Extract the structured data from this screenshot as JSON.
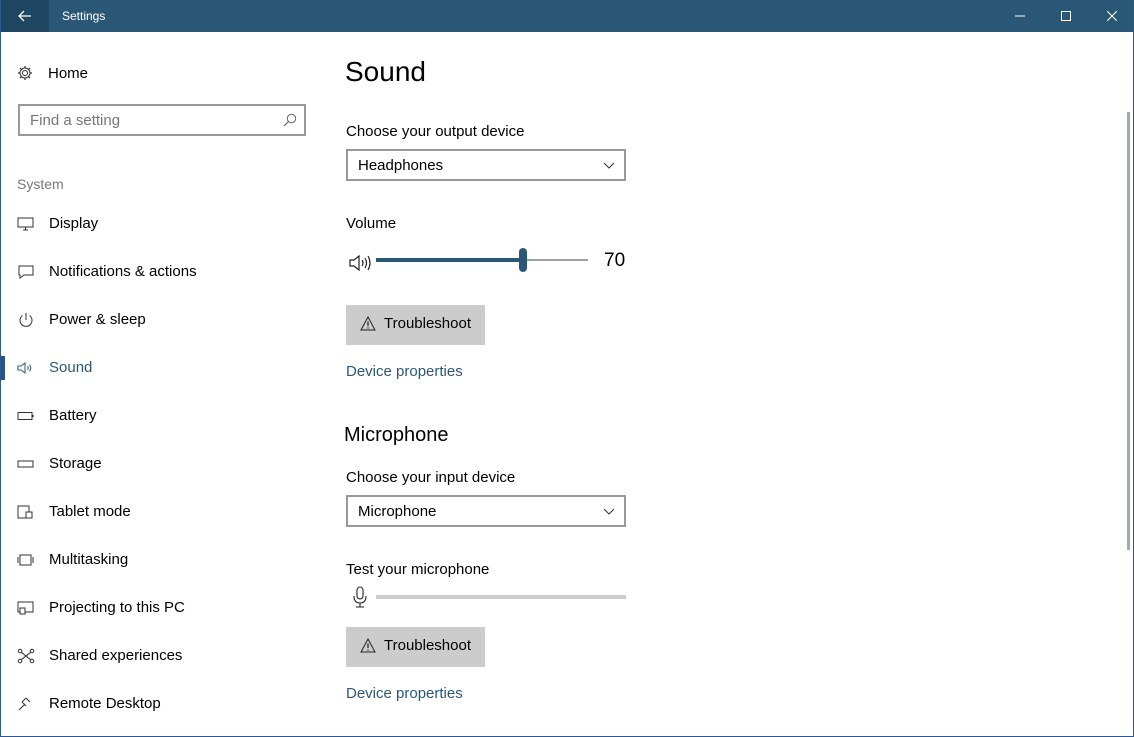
{
  "window": {
    "title": "Settings"
  },
  "sidebar": {
    "home_label": "Home",
    "search_placeholder": "Find a setting",
    "section_label": "System",
    "items": [
      {
        "label": "Display",
        "icon": "display-icon"
      },
      {
        "label": "Notifications & actions",
        "icon": "notifications-icon"
      },
      {
        "label": "Power & sleep",
        "icon": "power-icon"
      },
      {
        "label": "Sound",
        "icon": "speaker-icon",
        "active": true
      },
      {
        "label": "Battery",
        "icon": "battery-icon"
      },
      {
        "label": "Storage",
        "icon": "storage-icon"
      },
      {
        "label": "Tablet mode",
        "icon": "tablet-icon"
      },
      {
        "label": "Multitasking",
        "icon": "multitasking-icon"
      },
      {
        "label": "Projecting to this PC",
        "icon": "projecting-icon"
      },
      {
        "label": "Shared experiences",
        "icon": "shared-icon"
      },
      {
        "label": "Remote Desktop",
        "icon": "remote-desktop-icon"
      }
    ]
  },
  "main": {
    "title": "Sound",
    "output": {
      "label": "Choose your output device",
      "selected": "Headphones",
      "volume_label": "Volume",
      "volume_value": "70",
      "volume_fraction": 0.7,
      "troubleshoot_label": "Troubleshoot",
      "device_properties_label": "Device properties"
    },
    "microphone": {
      "section_title": "Microphone",
      "label": "Choose your input device",
      "selected": "Microphone",
      "test_label": "Test your microphone",
      "troubleshoot_label": "Troubleshoot",
      "device_properties_label": "Device properties"
    }
  },
  "colors": {
    "accent": "#2b5777",
    "titlebar": "#2b5777",
    "button_bg": "#cccccc"
  }
}
